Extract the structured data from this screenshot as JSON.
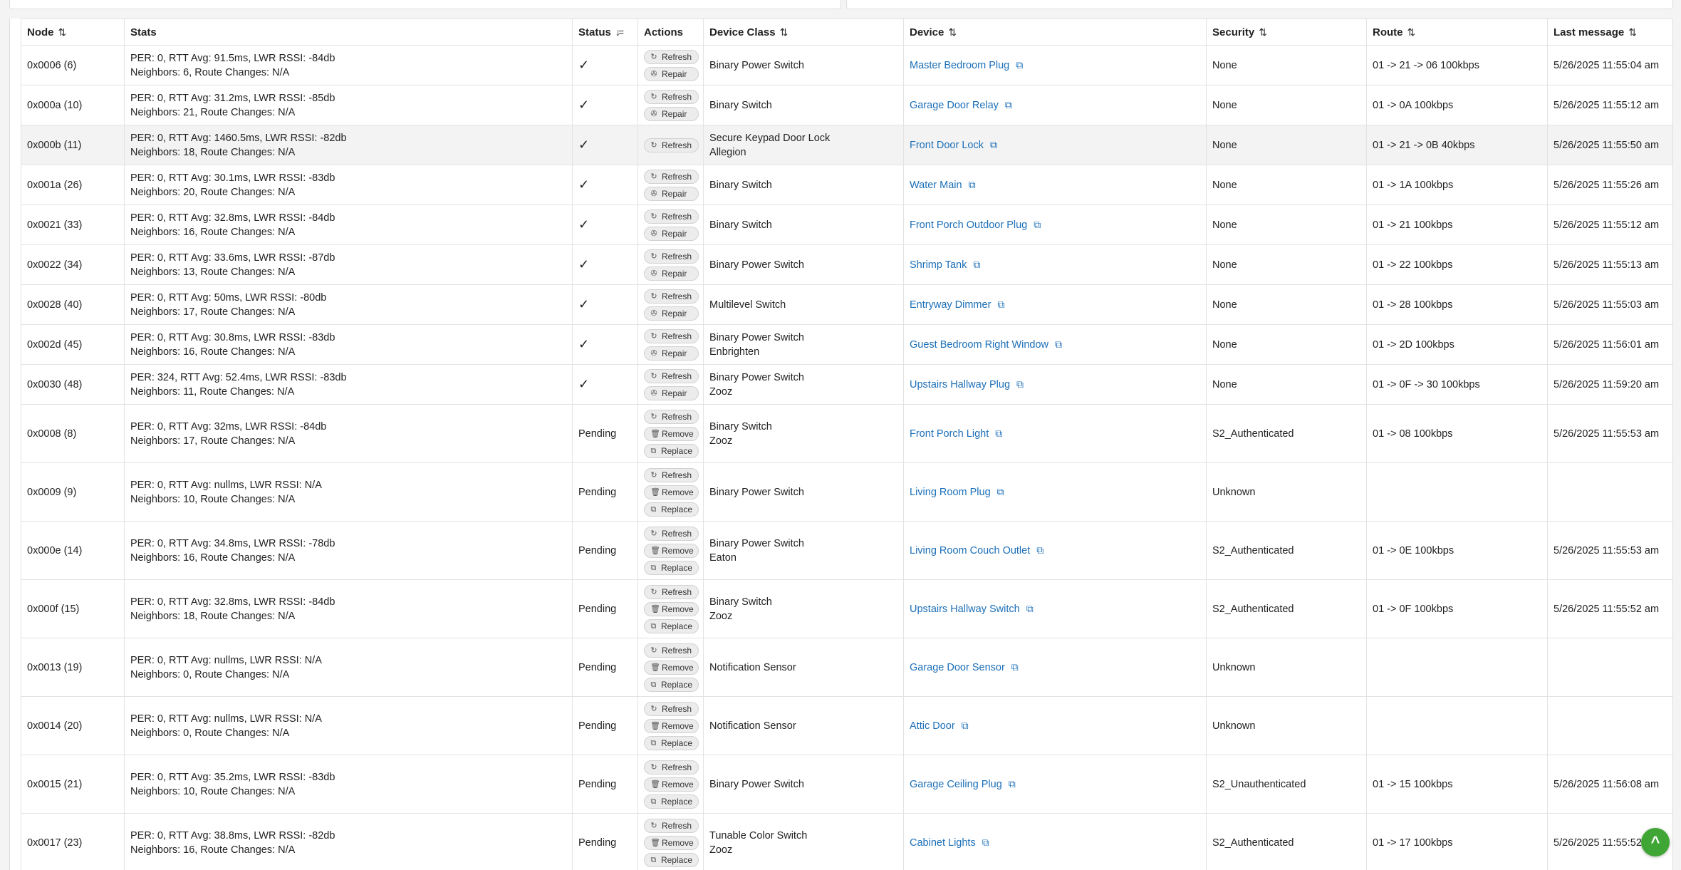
{
  "columns": [
    {
      "label": "Node",
      "sort": "⇅"
    },
    {
      "label": "Stats",
      "sort": ""
    },
    {
      "label": "Status",
      "sort": "↓="
    },
    {
      "label": "Actions",
      "sort": ""
    },
    {
      "label": "Device Class",
      "sort": "⇅"
    },
    {
      "label": "Device",
      "sort": "⇅"
    },
    {
      "label": "Security",
      "sort": "⇅"
    },
    {
      "label": "Route",
      "sort": "⇅"
    },
    {
      "label": "Last message",
      "sort": "⇅"
    }
  ],
  "rows": [
    {
      "node": "0x0006 (6)",
      "stats1": "PER: 0, RTT Avg: 91.5ms, LWR RSSI: -84db",
      "stats2": "Neighbors: 6, Route Changes: N/A",
      "status": "✓",
      "actions": [
        "Refresh",
        "Repair"
      ],
      "class1": "Binary Power Switch",
      "class2": "",
      "device": "Master Bedroom Plug",
      "security": "None",
      "route": "01 -> 21 -> 06 100kbps",
      "last": "5/26/2025 11:55:04 am"
    },
    {
      "node": "0x000a (10)",
      "stats1": "PER: 0, RTT Avg: 31.2ms, LWR RSSI: -85db",
      "stats2": "Neighbors: 21, Route Changes: N/A",
      "status": "✓",
      "actions": [
        "Refresh",
        "Repair"
      ],
      "class1": "Binary Switch",
      "class2": "",
      "device": "Garage Door Relay",
      "security": "None",
      "route": "01 -> 0A 100kbps",
      "last": "5/26/2025 11:55:12 am"
    },
    {
      "node": "0x000b (11)",
      "stats1": "PER: 0, RTT Avg: 1460.5ms, LWR RSSI: -82db",
      "stats2": "Neighbors: 18, Route Changes: N/A",
      "status": "✓",
      "actions": [
        "Refresh"
      ],
      "class1": "Secure Keypad Door Lock",
      "class2": "Allegion",
      "device": "Front Door Lock",
      "security": "None",
      "route": "01 -> 21 -> 0B 40kbps",
      "last": "5/26/2025 11:55:50 am"
    },
    {
      "node": "0x001a (26)",
      "stats1": "PER: 0, RTT Avg: 30.1ms, LWR RSSI: -83db",
      "stats2": "Neighbors: 20, Route Changes: N/A",
      "status": "✓",
      "actions": [
        "Refresh",
        "Repair"
      ],
      "class1": "Binary Switch",
      "class2": "",
      "device": "Water Main",
      "security": "None",
      "route": "01 -> 1A 100kbps",
      "last": "5/26/2025 11:55:26 am"
    },
    {
      "node": "0x0021 (33)",
      "stats1": "PER: 0, RTT Avg: 32.8ms, LWR RSSI: -84db",
      "stats2": "Neighbors: 16, Route Changes: N/A",
      "status": "✓",
      "actions": [
        "Refresh",
        "Repair"
      ],
      "class1": "Binary Switch",
      "class2": "",
      "device": "Front Porch Outdoor Plug",
      "security": "None",
      "route": "01 -> 21 100kbps",
      "last": "5/26/2025 11:55:12 am"
    },
    {
      "node": "0x0022 (34)",
      "stats1": "PER: 0, RTT Avg: 33.6ms, LWR RSSI: -87db",
      "stats2": "Neighbors: 13, Route Changes: N/A",
      "status": "✓",
      "actions": [
        "Refresh",
        "Repair"
      ],
      "class1": "Binary Power Switch",
      "class2": "",
      "device": "Shrimp Tank",
      "security": "None",
      "route": "01 -> 22 100kbps",
      "last": "5/26/2025 11:55:13 am"
    },
    {
      "node": "0x0028 (40)",
      "stats1": "PER: 0, RTT Avg: 50ms, LWR RSSI: -80db",
      "stats2": "Neighbors: 17, Route Changes: N/A",
      "status": "✓",
      "actions": [
        "Refresh",
        "Repair"
      ],
      "class1": "Multilevel Switch",
      "class2": "",
      "device": "Entryway Dimmer",
      "security": "None",
      "route": "01 -> 28 100kbps",
      "last": "5/26/2025 11:55:03 am"
    },
    {
      "node": "0x002d (45)",
      "stats1": "PER: 0, RTT Avg: 30.8ms, LWR RSSI: -83db",
      "stats2": "Neighbors: 16, Route Changes: N/A",
      "status": "✓",
      "actions": [
        "Refresh",
        "Repair"
      ],
      "class1": "Binary Power Switch",
      "class2": "Enbrighten",
      "device": "Guest Bedroom Right Window",
      "security": "None",
      "route": "01 -> 2D 100kbps",
      "last": "5/26/2025 11:56:01 am"
    },
    {
      "node": "0x0030 (48)",
      "stats1": "PER: 324, RTT Avg: 52.4ms, LWR RSSI: -83db",
      "stats2": "Neighbors: 11, Route Changes: N/A",
      "status": "✓",
      "actions": [
        "Refresh",
        "Repair"
      ],
      "class1": "Binary Power Switch",
      "class2": "Zooz",
      "device": "Upstairs Hallway Plug",
      "security": "None",
      "route": "01 -> 0F -> 30 100kbps",
      "last": "5/26/2025 11:59:20 am"
    },
    {
      "node": "0x0008 (8)",
      "stats1": "PER: 0, RTT Avg: 32ms, LWR RSSI: -84db",
      "stats2": "Neighbors: 17, Route Changes: N/A",
      "status": "Pending",
      "actions": [
        "Refresh",
        "Remove",
        "Replace"
      ],
      "class1": "Binary Switch",
      "class2": "Zooz",
      "device": "Front Porch Light",
      "security": "S2_Authenticated",
      "route": "01 -> 08 100kbps",
      "last": "5/26/2025 11:55:53 am"
    },
    {
      "node": "0x0009 (9)",
      "stats1": "PER: 0, RTT Avg: nullms, LWR RSSI: N/A",
      "stats2": "Neighbors: 10, Route Changes: N/A",
      "status": "Pending",
      "actions": [
        "Refresh",
        "Remove",
        "Replace"
      ],
      "class1": "Binary Power Switch",
      "class2": "",
      "device": "Living Room Plug",
      "security": "Unknown",
      "route": "",
      "last": ""
    },
    {
      "node": "0x000e (14)",
      "stats1": "PER: 0, RTT Avg: 34.8ms, LWR RSSI: -78db",
      "stats2": "Neighbors: 16, Route Changes: N/A",
      "status": "Pending",
      "actions": [
        "Refresh",
        "Remove",
        "Replace"
      ],
      "class1": "Binary Power Switch",
      "class2": "Eaton",
      "device": "Living Room Couch Outlet",
      "security": "S2_Authenticated",
      "route": "01 -> 0E 100kbps",
      "last": "5/26/2025 11:55:53 am"
    },
    {
      "node": "0x000f (15)",
      "stats1": "PER: 0, RTT Avg: 32.8ms, LWR RSSI: -84db",
      "stats2": "Neighbors: 18, Route Changes: N/A",
      "status": "Pending",
      "actions": [
        "Refresh",
        "Remove",
        "Replace"
      ],
      "class1": "Binary Switch",
      "class2": "Zooz",
      "device": "Upstairs Hallway Switch",
      "security": "S2_Authenticated",
      "route": "01 -> 0F 100kbps",
      "last": "5/26/2025 11:55:52 am"
    },
    {
      "node": "0x0013 (19)",
      "stats1": "PER: 0, RTT Avg: nullms, LWR RSSI: N/A",
      "stats2": "Neighbors: 0, Route Changes: N/A",
      "status": "Pending",
      "actions": [
        "Refresh",
        "Remove",
        "Replace"
      ],
      "class1": "Notification Sensor",
      "class2": "",
      "device": "Garage Door Sensor",
      "security": "Unknown",
      "route": "",
      "last": ""
    },
    {
      "node": "0x0014 (20)",
      "stats1": "PER: 0, RTT Avg: nullms, LWR RSSI: N/A",
      "stats2": "Neighbors: 0, Route Changes: N/A",
      "status": "Pending",
      "actions": [
        "Refresh",
        "Remove",
        "Replace"
      ],
      "class1": "Notification Sensor",
      "class2": "",
      "device": "Attic Door",
      "security": "Unknown",
      "route": "",
      "last": ""
    },
    {
      "node": "0x0015 (21)",
      "stats1": "PER: 0, RTT Avg: 35.2ms, LWR RSSI: -83db",
      "stats2": "Neighbors: 10, Route Changes: N/A",
      "status": "Pending",
      "actions": [
        "Refresh",
        "Remove",
        "Replace"
      ],
      "class1": "Binary Power Switch",
      "class2": "",
      "device": "Garage Ceiling Plug",
      "security": "S2_Unauthenticated",
      "route": "01 -> 15 100kbps",
      "last": "5/26/2025 11:56:08 am"
    },
    {
      "node": "0x0017 (23)",
      "stats1": "PER: 0, RTT Avg: 38.8ms, LWR RSSI: -82db",
      "stats2": "Neighbors: 16, Route Changes: N/A",
      "status": "Pending",
      "actions": [
        "Refresh",
        "Remove",
        "Replace"
      ],
      "class1": "Tunable Color Switch",
      "class2": "Zooz",
      "device": "Cabinet Lights",
      "security": "S2_Authenticated",
      "route": "01 -> 17 100kbps",
      "last": "5/26/2025 11:55:52 am"
    }
  ],
  "icons": {
    "Refresh": "↻",
    "Repair": "✇",
    "Remove": "🗑",
    "Replace": "⧉",
    "external": "⧉"
  },
  "fab_icon": "^",
  "colors": {
    "link": "#1c6fb8",
    "fab": "#3fa535"
  }
}
